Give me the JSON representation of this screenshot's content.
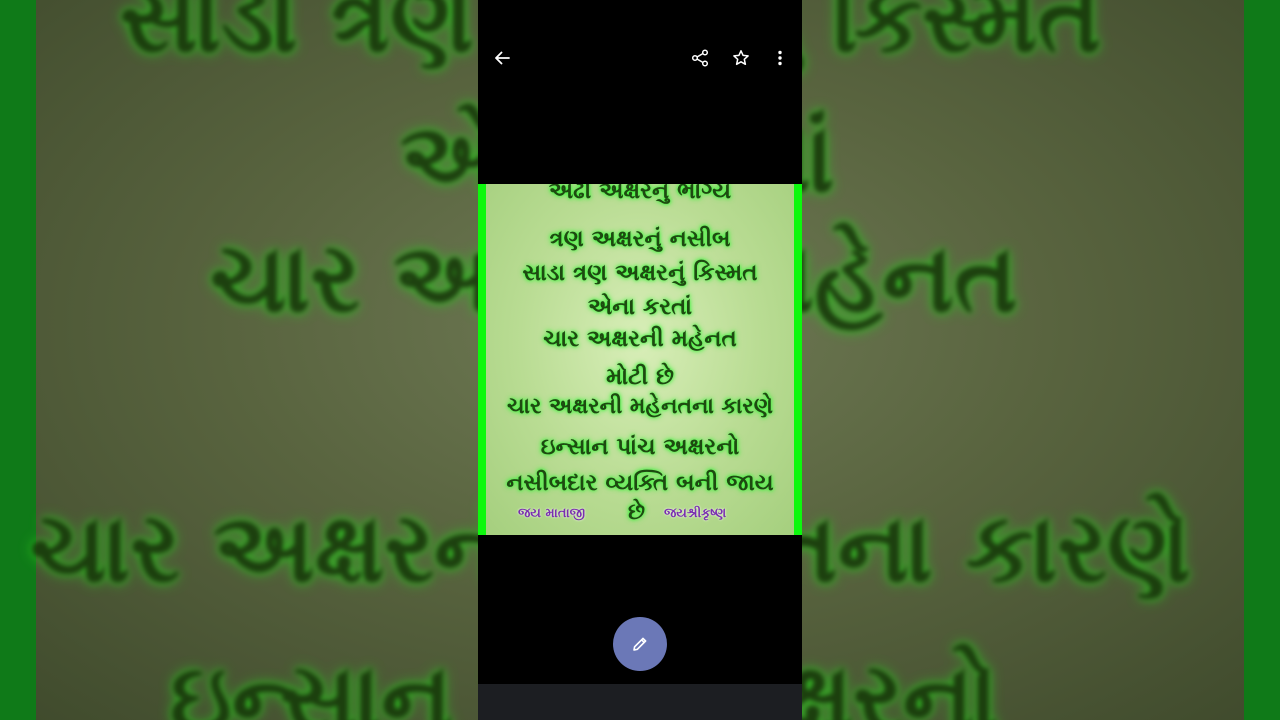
{
  "backdrop": {
    "lines": [
      "સાડા ત્રણ અક્ષરનું કિસ્મત",
      "એના કરતાં",
      "ચાર અક્ષરની મહેનત",
      "ચાર અક્ષરની મહેનતના કારણે",
      "ઇન્સાન પાંચ અક્ષરનો"
    ]
  },
  "toolbar": {
    "back_icon": "arrow-left-icon",
    "share_icon": "share-icon",
    "star_icon": "star-outline-icon",
    "more_icon": "more-vert-icon"
  },
  "photo": {
    "lines": [
      "અઢી અક્ષરનું ભાગ્ય",
      "ત્રણ અક્ષરનું નસીબ",
      "સાડા ત્રણ અક્ષરનું કિસ્મત",
      "એના કરતાં",
      "ચાર અક્ષરની મહેનત",
      "મોટી છે",
      "ચાર અક્ષરની મહેનતના કારણે",
      "ઇન્સાન પાંચ અક્ષરનો",
      "નસીબદાર વ્યક્તિ બની જાય"
    ],
    "footer_left": "જય માતાજી",
    "footer_mid": "છે",
    "footer_right": "જયશ્રીકૃષ્ણ"
  },
  "fab": {
    "icon": "pencil-edit-icon"
  },
  "colors": {
    "frame_green": "#0df80d",
    "text_green": "#1d4a10",
    "footer_purple": "#7a2fb0",
    "fab_blue": "#6b78b7"
  }
}
